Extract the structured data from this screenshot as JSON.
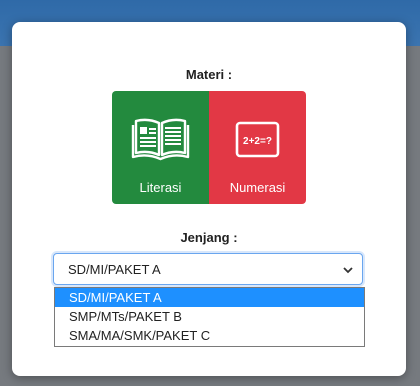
{
  "materi": {
    "title": "Materi :",
    "tiles": [
      {
        "label": "Literasi",
        "icon": "open-book-icon",
        "color": "#238a3e"
      },
      {
        "label": "Numerasi",
        "icon": "math-board-icon",
        "color": "#e23845"
      }
    ],
    "board_text": "2+2=?"
  },
  "jenjang": {
    "title": "Jenjang :",
    "selected": "SD/MI/PAKET A",
    "options": [
      "SD/MI/PAKET A",
      "SMP/MTs/PAKET B",
      "SMA/MA/SMK/PAKET C"
    ],
    "highlight_color": "#1e90ff"
  }
}
